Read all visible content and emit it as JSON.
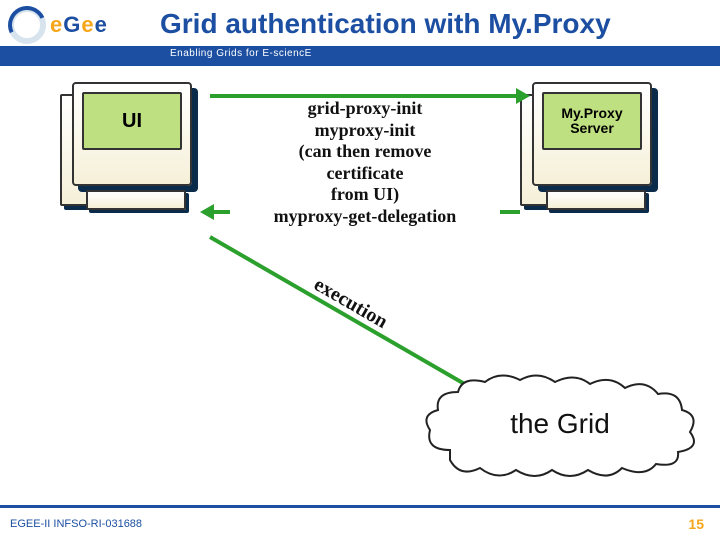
{
  "header": {
    "logo_text_html": "eGee",
    "title": "Grid authentication with My.Proxy",
    "subtitle": "Enabling Grids for E-sciencE"
  },
  "diagram": {
    "ui_label": "UI",
    "server_label": "My.Proxy Server",
    "mid_lines": [
      "grid-proxy-init",
      "myproxy-init",
      "(can then remove",
      "certificate",
      "from UI)",
      "myproxy-get-delegation"
    ],
    "exec_label": "execution",
    "cloud_label": "the Grid"
  },
  "footer": {
    "left": "EGEE-II INFSO-RI-031688",
    "page": "15"
  }
}
